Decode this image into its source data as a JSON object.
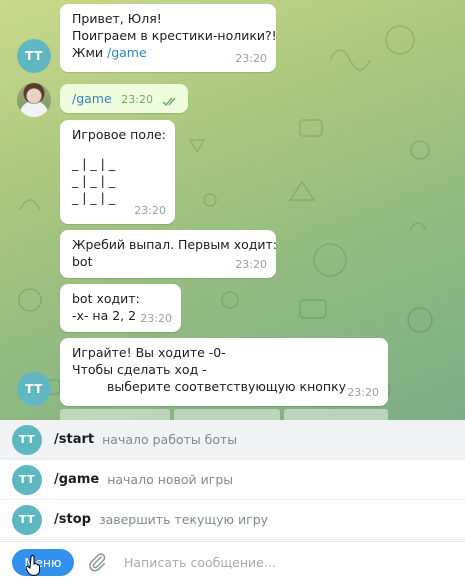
{
  "colors": {
    "accent": "#3390ec",
    "bot_avatar": "#5fb8c1",
    "outgoing_bubble": "#effdde",
    "incoming_bubble": "#ffffff",
    "link": "#2e86c1",
    "read_checks": "#6fab5d"
  },
  "messages": [
    {
      "sender": "bot",
      "avatar": "TT",
      "lines": [
        "Привет, Юля!",
        "Поиграем в крестики-нолики?!",
        "Жми "
      ],
      "link": "/game",
      "time": "23:20"
    },
    {
      "sender": "user",
      "text": "/game",
      "time": "23:20",
      "status_icon": "double-check-icon"
    },
    {
      "sender": "bot",
      "lines": [
        "Игровое поле:",
        "",
        "_ | _ | _",
        "_ | _ | _",
        "_ | _ | _"
      ],
      "time": "23:20"
    },
    {
      "sender": "bot",
      "lines": [
        "Жребий выпал. Первым ходит:",
        "bot"
      ],
      "time": "23:20"
    },
    {
      "sender": "bot",
      "lines": [
        "bot ходит:",
        "-x- на 2, 2"
      ],
      "time": "23:20"
    },
    {
      "sender": "bot",
      "avatar": "TT",
      "lines": [
        "Играйте! Вы ходите -0-",
        "Чтобы сделать ход -",
        "выберите соответствующую кнопку"
      ],
      "time": "23:20"
    }
  ],
  "commands": [
    {
      "avatar": "TT",
      "name": "/start",
      "description": "начало работы боты"
    },
    {
      "avatar": "TT",
      "name": "/game",
      "description": "начало новой игры"
    },
    {
      "avatar": "TT",
      "name": "/stop",
      "description": "завершить текущую игру"
    }
  ],
  "input_bar": {
    "menu_label": "Меню",
    "attach_icon": "paperclip-icon",
    "placeholder": "Написать сообщение..."
  }
}
